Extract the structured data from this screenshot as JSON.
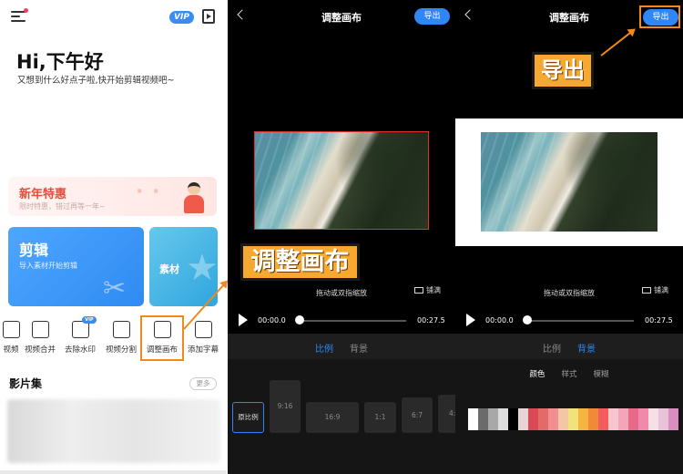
{
  "home": {
    "vip_badge": "VIP",
    "greeting": "Hi,下午好",
    "subtitle": "又想到什么好点子啦,快开始剪辑视频吧~",
    "promo": {
      "title": "新年特惠",
      "subtitle": "限时特惠，错过再等一年~"
    },
    "card_edit": {
      "title": "剪辑",
      "subtitle": "导入素材开始剪辑"
    },
    "card_material": {
      "title": "素材"
    },
    "tools": [
      "视频",
      "视频合并",
      "去除水印",
      "视频分割",
      "调整画布",
      "添加字幕"
    ],
    "new_badge": "VIP",
    "album_title": "影片集",
    "more_label": "更多"
  },
  "editor_ratio": {
    "title": "调整画布",
    "export_label": "导出",
    "hint": "拖动或双指缩放",
    "fill_label": "铺满",
    "time_current": "00:00.0",
    "time_total": "00:27.5",
    "tabs": [
      "比例",
      "背景"
    ],
    "active_tab": "比例",
    "ratios": [
      "原比例",
      "9:16",
      "16:9",
      "1:1",
      "6:7",
      "4:"
    ]
  },
  "editor_background": {
    "title": "调整画布",
    "export_label": "导出",
    "hint": "拖动或双指缩放",
    "fill_label": "铺满",
    "time_current": "00:00.0",
    "time_total": "00:27.5",
    "tabs": [
      "比例",
      "背景"
    ],
    "active_tab": "背景",
    "subtabs": [
      "颜色",
      "样式",
      "模糊"
    ],
    "active_subtab": "颜色",
    "swatches": [
      "#ffffff",
      "#6b6b6b",
      "#a8a8a8",
      "#dcdcdc",
      "#000000",
      "#e8d4d4",
      "#d94a55",
      "#e36a6a",
      "#ef8f8f",
      "#f3c6a6",
      "#f2e27a",
      "#f5b540",
      "#f08a3a",
      "#f25c5c",
      "#f7c5cc",
      "#f4a6b8",
      "#e86a8a",
      "#f08aaa",
      "#f5e0e6",
      "#e8c2d8",
      "#d88fc0"
    ]
  },
  "callouts": {
    "canvas": "调整画布",
    "export": "导出"
  },
  "colors": {
    "accent": "#2f86f6",
    "highlight": "#f08a1c",
    "callout_fill": "#f7a830"
  }
}
